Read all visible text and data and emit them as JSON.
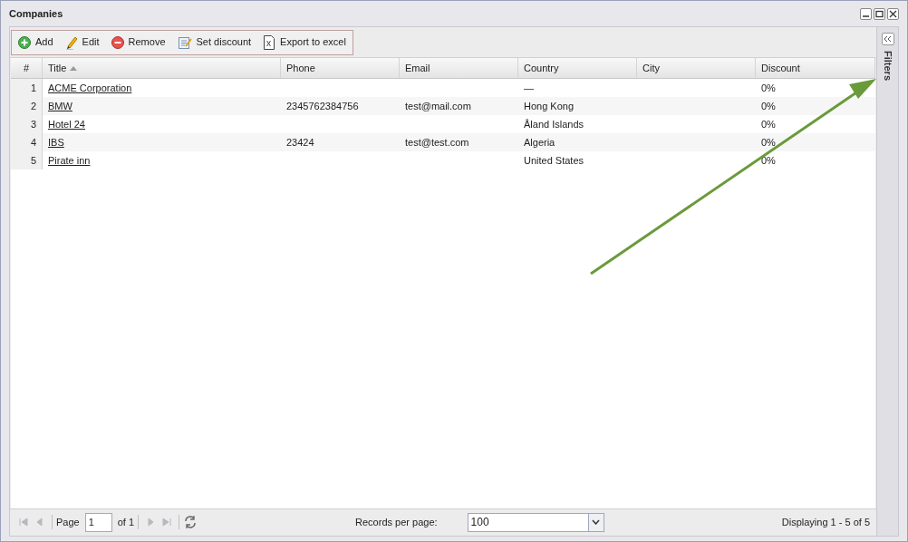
{
  "window": {
    "title": "Companies"
  },
  "toolbar": [
    {
      "kind": "add",
      "label": "Add"
    },
    {
      "kind": "edit",
      "label": "Edit"
    },
    {
      "kind": "remove",
      "label": "Remove"
    },
    {
      "kind": "discount",
      "label": "Set discount"
    },
    {
      "kind": "excel",
      "label": "Export to excel"
    }
  ],
  "table": {
    "columns": [
      {
        "label": "#",
        "sorted": false
      },
      {
        "label": "Title",
        "sorted": true
      },
      {
        "label": "Phone",
        "sorted": false
      },
      {
        "label": "Email",
        "sorted": false
      },
      {
        "label": "Country",
        "sorted": false
      },
      {
        "label": "City",
        "sorted": false
      },
      {
        "label": "Discount",
        "sorted": false
      }
    ],
    "rows": [
      [
        "1",
        "ACME Corporation",
        "",
        "",
        "—",
        "",
        "0%"
      ],
      [
        "2",
        "BMW",
        "2345762384756",
        "test@mail.com",
        "Hong Kong",
        "",
        "0%"
      ],
      [
        "3",
        "Hotel 24",
        "",
        "",
        "Åland Islands",
        "",
        "0%"
      ],
      [
        "4",
        "IBS",
        "23424",
        "test@test.com",
        "Algeria",
        "",
        "0%"
      ],
      [
        "5",
        "Pirate inn",
        "",
        "",
        "United States",
        "",
        "0%"
      ]
    ]
  },
  "filters_panel": {
    "label": "Filters"
  },
  "pager": {
    "page_label": "Page",
    "page": "1",
    "of_label": "of 1",
    "records_label": "Records per page:",
    "records_per_page": "100",
    "displaying": "Displaying 1 - 5 of 5"
  }
}
